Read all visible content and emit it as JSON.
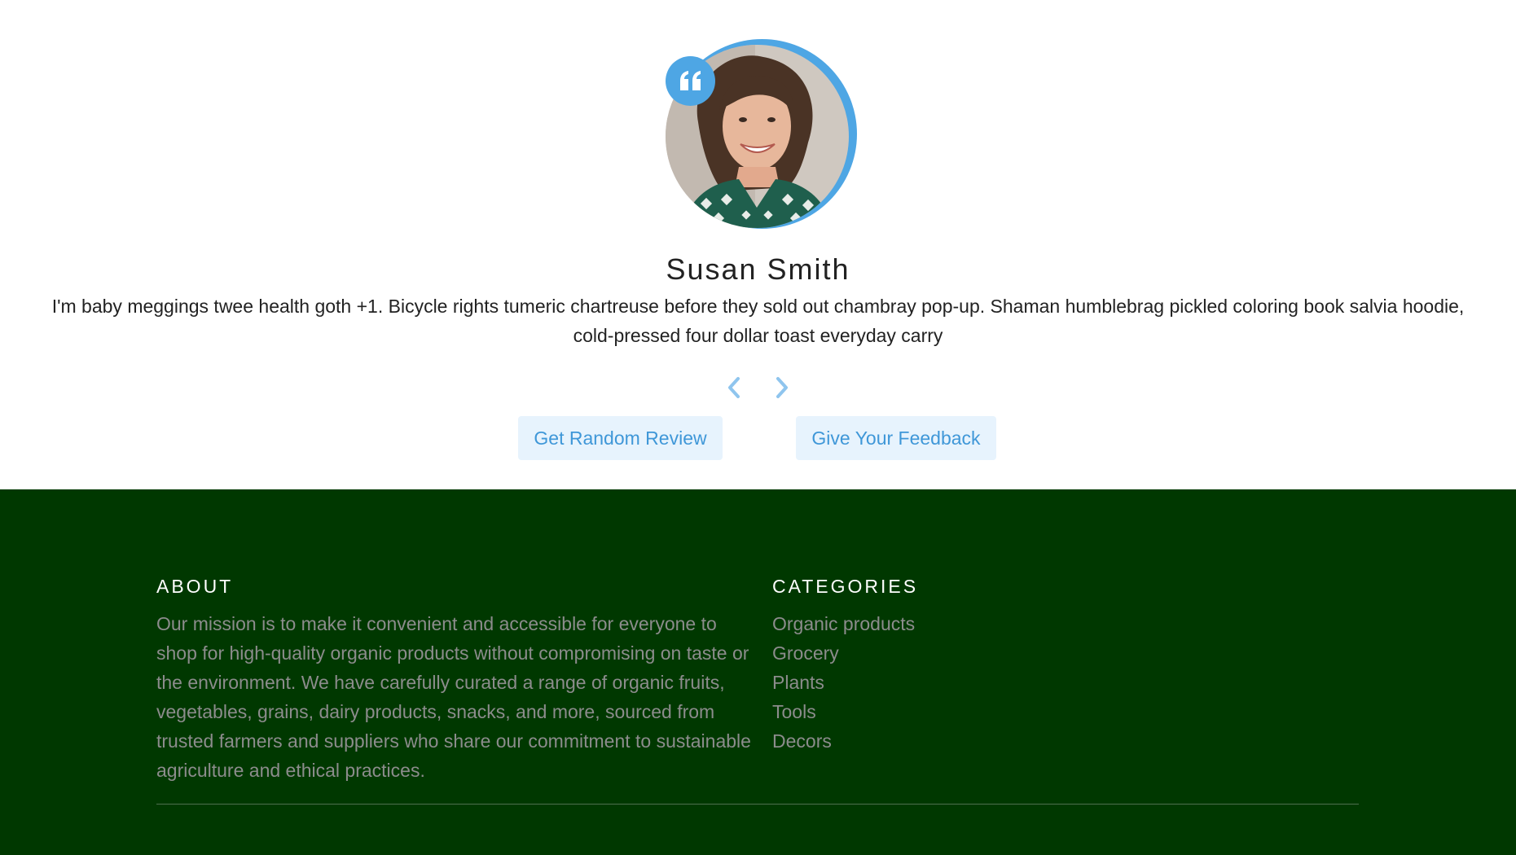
{
  "review": {
    "name": "Susan Smith",
    "text": "I'm baby meggings twee health goth +1. Bicycle rights tumeric chartreuse before they sold out chambray pop-up. Shaman humblebrag pickled coloring book salvia hoodie, cold-pressed four dollar toast everyday carry",
    "avatar_icon": "person-portrait",
    "quote_icon": "quote-icon"
  },
  "navigation": {
    "prev_icon": "chevron-left-icon",
    "next_icon": "chevron-right-icon"
  },
  "buttons": {
    "random": "Get Random Review",
    "feedback": "Give Your Feedback"
  },
  "footer": {
    "about": {
      "heading": "ABOUT",
      "text": "Our mission is to make it convenient and accessible for everyone to shop for high-quality organic products without compromising on taste or the environment. We have carefully curated a range of organic fruits, vegetables, grains, dairy products, snacks, and more, sourced from trusted farmers and suppliers who share our commitment to sustainable agriculture and ethical practices."
    },
    "categories": {
      "heading": "CATEGORIES",
      "items": [
        "Organic products",
        "Grocery",
        "Plants",
        "Tools",
        "Decors"
      ]
    }
  },
  "colors": {
    "accent": "#4ea6e4",
    "button_bg": "#e7f3fd",
    "footer_bg": "#003800",
    "footer_text": "#8c8c8c"
  }
}
